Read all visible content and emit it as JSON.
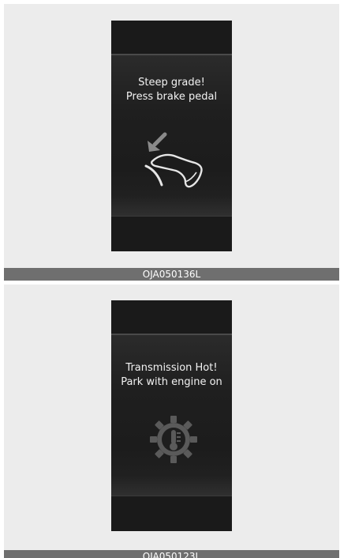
{
  "panels": [
    {
      "message_line1": "Steep grade!",
      "message_line2": "Press brake pedal",
      "icon": "foot-brake-pedal-icon",
      "caption": "OJA050136L"
    },
    {
      "message_line1": "Transmission Hot!",
      "message_line2": "Park with engine on",
      "icon": "transmission-temperature-gear-icon",
      "caption": "OJA050123L"
    }
  ],
  "colors": {
    "page_background": "#ffffff",
    "panel_background": "#ececec",
    "display_background": "#1a1a1a",
    "caption_bar": "#6f6f6f",
    "message_text": "#f2f2f2"
  }
}
